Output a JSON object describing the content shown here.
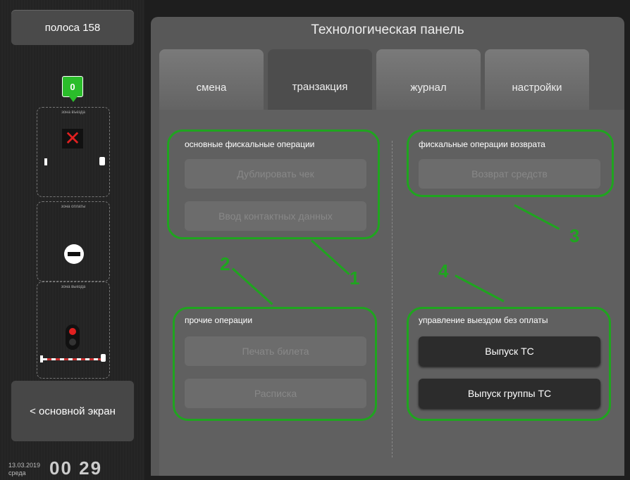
{
  "sidebar": {
    "lane_label": "полоса 158",
    "counter": "0",
    "zones": [
      "зона въезда",
      "зона оплаты",
      "зона выезда"
    ],
    "main_screen_label": "< основной экран",
    "date": "13.03.2019",
    "weekday": "среда",
    "time": "00 29"
  },
  "panel": {
    "title": "Технологическая панель",
    "tabs": [
      "смена",
      "транзакция",
      "журнал",
      "настройки"
    ],
    "active_tab": "транзакция"
  },
  "sections": {
    "fiscal": {
      "title": "основные фискальные операции",
      "buttons": [
        "Дублировать чек",
        "Ввод контактных данных"
      ]
    },
    "refund": {
      "title": "фискальные операции возврата",
      "buttons": [
        "Возврат средств"
      ]
    },
    "other": {
      "title": "прочие операции",
      "buttons": [
        "Печать билета",
        "Расписка"
      ]
    },
    "exit": {
      "title": "управление выездом без оплаты",
      "buttons": [
        "Выпуск ТС",
        "Выпуск группы ТС"
      ]
    }
  },
  "annotations": [
    "1",
    "2",
    "3",
    "4"
  ],
  "colors": {
    "annotation": "#1fa51f",
    "counter": "#2bbd2b",
    "alert": "#e02020"
  }
}
